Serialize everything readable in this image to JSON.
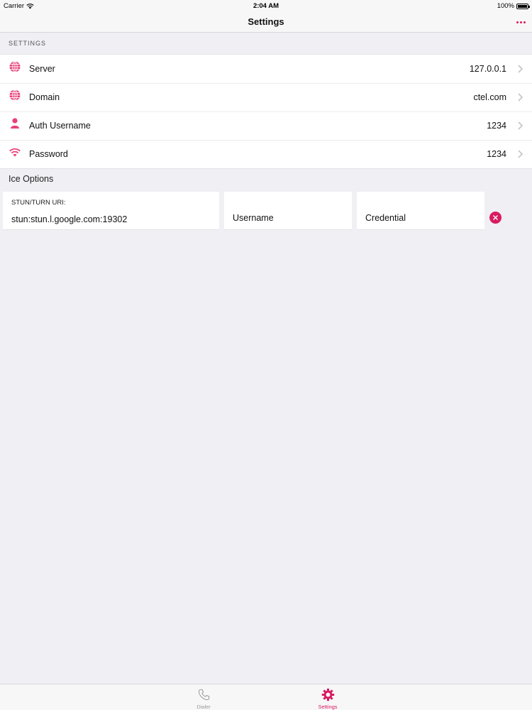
{
  "status_bar": {
    "carrier": "Carrier",
    "time": "2:04 AM",
    "battery": "100%",
    "battery_level": 1.0
  },
  "nav": {
    "title": "Settings",
    "more_icon": "more-dots-icon"
  },
  "settings_section": {
    "header": "SETTINGS",
    "rows": [
      {
        "icon": "globe-icon",
        "label": "Server",
        "value": "127.0.0.1"
      },
      {
        "icon": "globe-icon",
        "label": "Domain",
        "value": "ctel.com"
      },
      {
        "icon": "person-icon",
        "label": "Auth Username",
        "value": "1234"
      },
      {
        "icon": "wifi-icon",
        "label": "Password",
        "value": "1234"
      }
    ]
  },
  "ice_options": {
    "header": "Ice Options",
    "uri_label": "STUN/TURN URI:",
    "uri_value": "stun:stun.l.google.com:19302",
    "username_placeholder": "Username",
    "credential_placeholder": "Credential",
    "remove_icon": "remove-circle-icon"
  },
  "tab_bar": {
    "tabs": [
      {
        "label": "Dialer",
        "icon": "phone-icon",
        "active": false
      },
      {
        "label": "Settings",
        "icon": "gear-icon",
        "active": true
      }
    ]
  },
  "colors": {
    "accent": "#d81b60",
    "background": "#efeff4",
    "cell": "#ffffff"
  }
}
